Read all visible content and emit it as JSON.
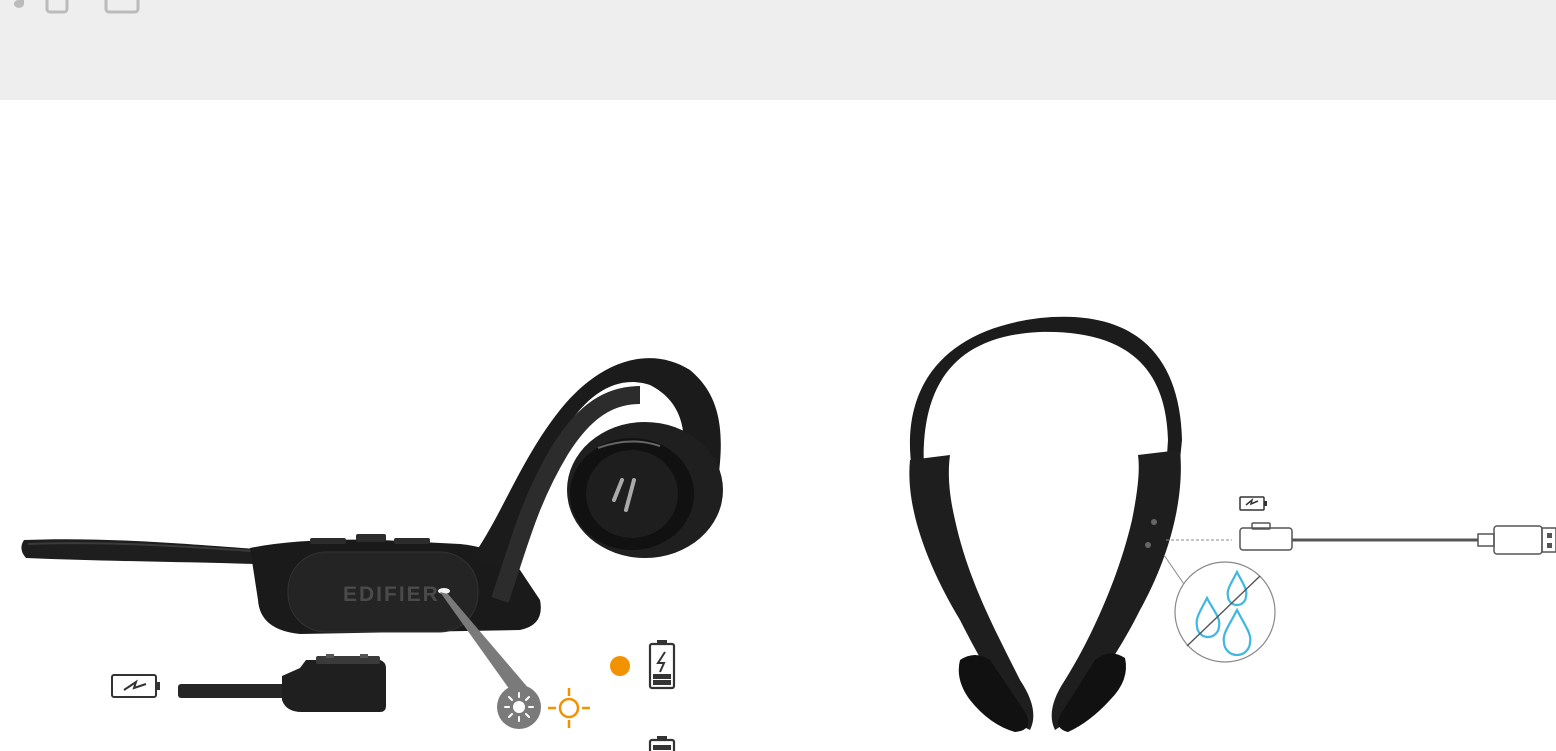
{
  "brand": {
    "wordmark": "EDIFIER"
  },
  "icons": {
    "top_band": [
      "music-note-icon",
      "device-icon",
      "device-icon"
    ],
    "left_scene": [
      "battery-charging-icon",
      "sun-brightness-icon",
      "sun-outline-icon",
      "battery-full-icon",
      "battery-low-icon"
    ],
    "right_scene": [
      "battery-charging-icon",
      "water-drop-icon",
      "usb-connector-icon"
    ]
  },
  "colors": {
    "band": "#eeeeee",
    "product": "#1c1c1c",
    "led_amber": "#f39200",
    "water_blue": "#3fb7e0",
    "callout_grey": "#7a7a7a"
  }
}
